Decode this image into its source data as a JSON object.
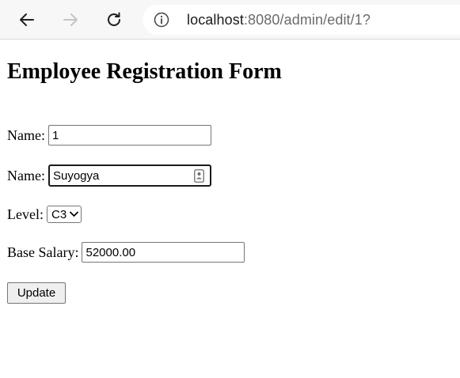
{
  "browser": {
    "url_host": "localhost",
    "url_rest": ":8080/admin/edit/1?",
    "icons": [
      "back-arrow-icon",
      "forward-arrow-icon",
      "reload-icon",
      "info-icon"
    ]
  },
  "page": {
    "title": "Employee Registration Form"
  },
  "form": {
    "id_label": "Name:",
    "id_value": "1",
    "name_label": "Name:",
    "name_value": "Suyogya",
    "level_label": "Level:",
    "level_value": "C3",
    "salary_label": "Base Salary:",
    "salary_value": "52000.00",
    "submit_label": "Update"
  },
  "colors": {
    "toolbar_bg": "#f7f7f7",
    "url_host": "#1a1a1a",
    "url_rest": "#6b6b6b",
    "button_bg": "#efefef"
  }
}
